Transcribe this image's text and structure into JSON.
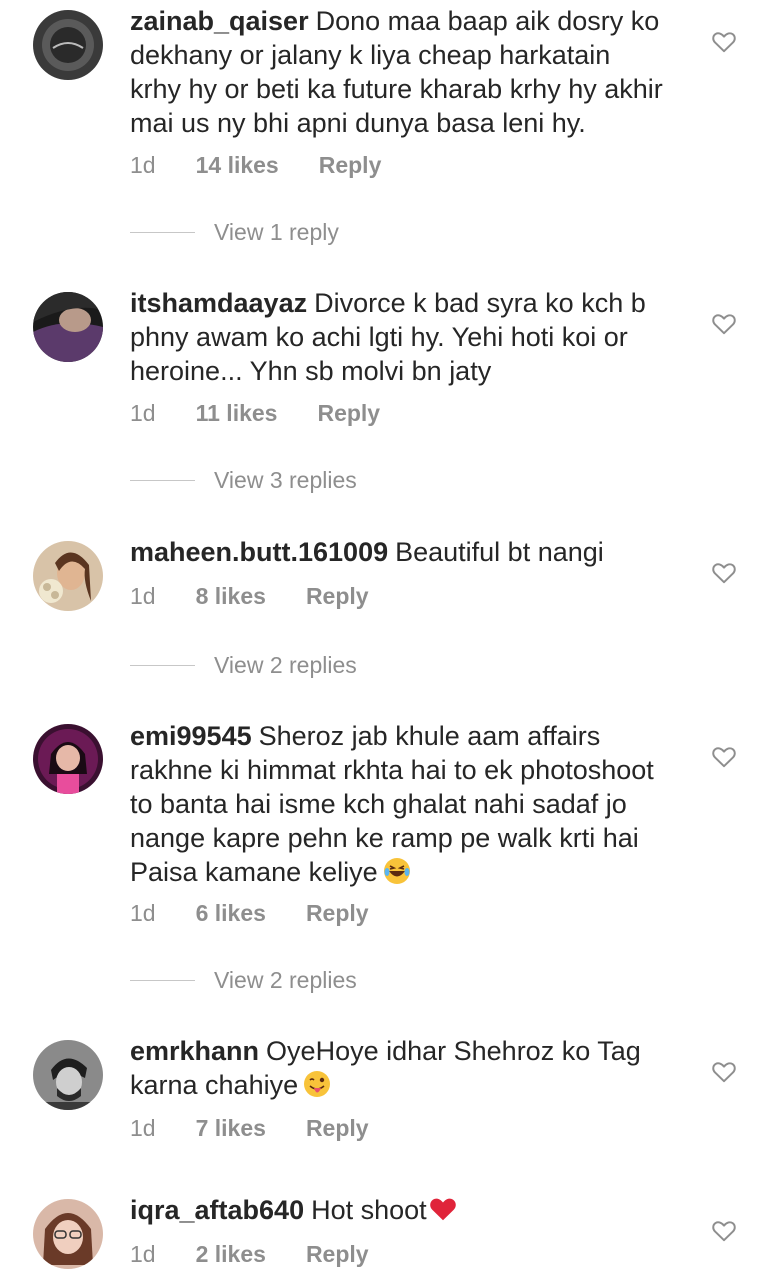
{
  "comments": [
    {
      "username": "zainab_qaiser",
      "text": "Dono maa baap aik dosry ko\ndekhany or jalany  k liya cheap harkatain\nkrhy hy or beti ka future kharab krhy hy akhir\nmai us ny bhi apni dunya basa leni hy.",
      "time": "1d",
      "likes": "14 likes",
      "reply": "Reply",
      "view_replies": "View 1 reply"
    },
    {
      "username": "itshamdaayaz",
      "text": "Divorce k bad syra ko kch b\nphny awam ko achi lgti hy. Yehi hoti koi or\nheroine... Yhn sb molvi bn jaty",
      "time": "1d",
      "likes": "11 likes",
      "reply": "Reply",
      "view_replies": "View 3 replies"
    },
    {
      "username": "maheen.butt.161009",
      "text": "Beautiful bt nangi",
      "time": "1d",
      "likes": "8 likes",
      "reply": "Reply",
      "view_replies": "View 2 replies"
    },
    {
      "username": "emi99545",
      "text": "Sheroz jab khule aam affairs\nrakhne ki himmat rkhta hai to ek photoshoot\nto banta hai isme kch ghalat nahi sadaf jo\nnange kapre pehn ke ramp pe walk krti hai\nPaisa kamane keliye",
      "emoji": "😂",
      "time": "1d",
      "likes": "6 likes",
      "reply": "Reply",
      "view_replies": "View 2 replies"
    },
    {
      "username": "emrkhann",
      "text": "OyeHoye idhar Shehroz ko Tag\nkarna chahiye",
      "emoji": "😜",
      "time": "1d",
      "likes": "7 likes",
      "reply": "Reply"
    },
    {
      "username": "iqra_aftab640",
      "text": "Hot shoot",
      "emoji": "❤️",
      "time": "1d",
      "likes": "2 likes",
      "reply": "Reply"
    }
  ],
  "icons": {
    "like": "heart-outline-icon"
  },
  "colors": {
    "text": "#262626",
    "meta": "#8e8e8e",
    "divider": "#c7c7c7"
  }
}
